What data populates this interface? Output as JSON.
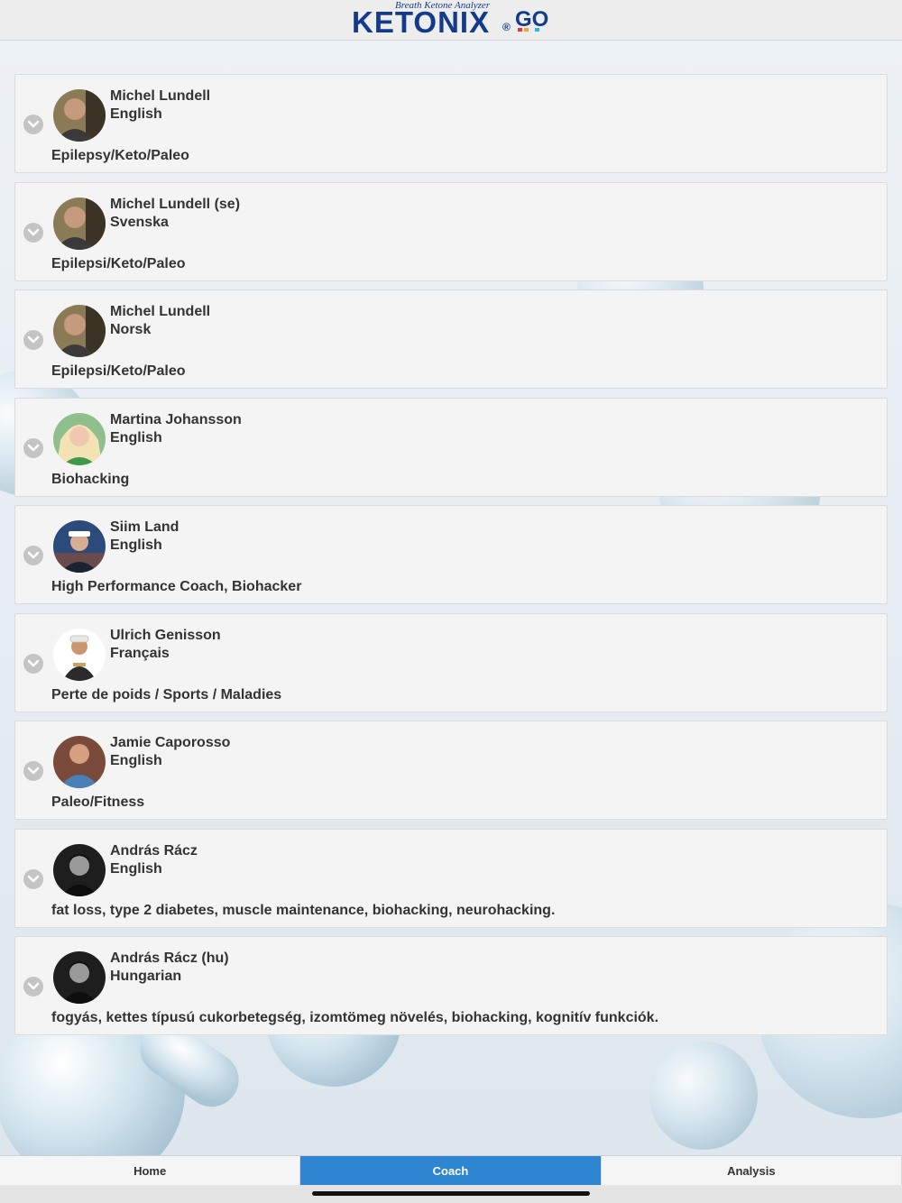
{
  "brand": {
    "tagline": "Breath Ketone Analyzer",
    "name": "KETONIX",
    "registered": "®",
    "suffix": "GO",
    "colors": {
      "navy": "#143a8a",
      "accent_blue": "#2f86d0"
    }
  },
  "coaches": [
    {
      "name": "Michel Lundell",
      "language": "English",
      "specialty": "Epilepsy/Keto/Paleo",
      "avatar": "man-dark-jacket"
    },
    {
      "name": "Michel Lundell (se)",
      "language": "Svenska",
      "specialty": "Epilepsi/Keto/Paleo",
      "avatar": "man-dark-jacket"
    },
    {
      "name": "Michel Lundell",
      "language": "Norsk",
      "specialty": "Epilepsi/Keto/Paleo",
      "avatar": "man-dark-jacket"
    },
    {
      "name": "Martina Johansson",
      "language": "English",
      "specialty": "Biohacking",
      "avatar": "woman-blonde-green"
    },
    {
      "name": "Siim Land",
      "language": "English",
      "specialty": "High Performance Coach, Biohacker",
      "avatar": "man-cap-blue"
    },
    {
      "name": "Ulrich Genisson",
      "language": "Français",
      "specialty": "Perte de poids / Sports / Maladies",
      "avatar": "man-cap-white"
    },
    {
      "name": "Jamie Caporosso",
      "language": "English",
      "specialty": "Paleo/Fitness",
      "avatar": "man-shaved-blue-shirt"
    },
    {
      "name": "András Rácz",
      "language": "English",
      "specialty": "fat loss, type 2 diabetes, muscle maintenance, biohacking, neurohacking.",
      "avatar": "man-dark-bw"
    },
    {
      "name": "András Rácz (hu)",
      "language": "Hungarian",
      "specialty": "fogyás, kettes típusú cukorbetegség, izomtömeg növelés, biohacking, kognitív funkciók.",
      "avatar": "man-dark-bw"
    }
  ],
  "tabs": [
    {
      "label": "Home",
      "active": false
    },
    {
      "label": "Coach",
      "active": true
    },
    {
      "label": "Analysis",
      "active": false
    }
  ]
}
